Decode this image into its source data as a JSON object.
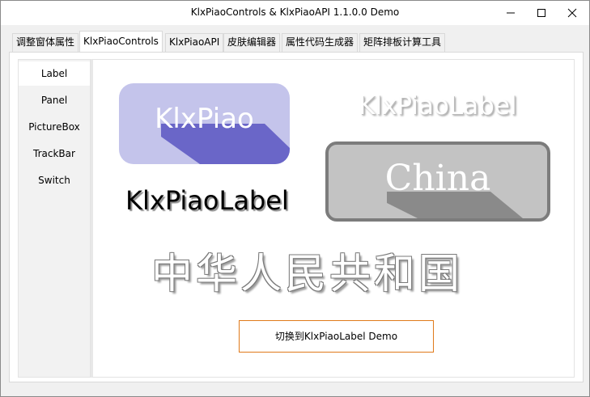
{
  "window": {
    "title": "KlxPiaoControls & KlxPiaoAPI 1.1.0.0 Demo"
  },
  "tabs": [
    {
      "label": "调整窗体属性"
    },
    {
      "label": "KlxPiaoControls"
    },
    {
      "label": "KlxPiaoAPI"
    },
    {
      "label": "皮肤编辑器"
    },
    {
      "label": "属性代码生成器"
    },
    {
      "label": "矩阵排板计算工具"
    }
  ],
  "sidebar": {
    "items": [
      {
        "label": "Label"
      },
      {
        "label": "Panel"
      },
      {
        "label": "PictureBox"
      },
      {
        "label": "TrackBar"
      },
      {
        "label": "Switch"
      }
    ]
  },
  "demo": {
    "purple_label": "KlxPiao",
    "ghost_label": "KlxPiaoLabel",
    "black_label": "KlxPiaoLabel",
    "china_label": "China",
    "chinese_label": "中华人民共和国",
    "switch_button": "切换到KlxPiaoLabel Demo"
  },
  "colors": {
    "purple_bg": "#c4c4eb",
    "purple_shadow": "#6a66c8",
    "gray_bg": "#c3c3c3",
    "gray_border": "#7c7c7c",
    "gray_shadow": "#8a8a8a",
    "button_border": "#e07a1a"
  },
  "icons": {
    "minimize": "minimize-icon",
    "maximize": "maximize-icon",
    "close": "close-icon"
  }
}
